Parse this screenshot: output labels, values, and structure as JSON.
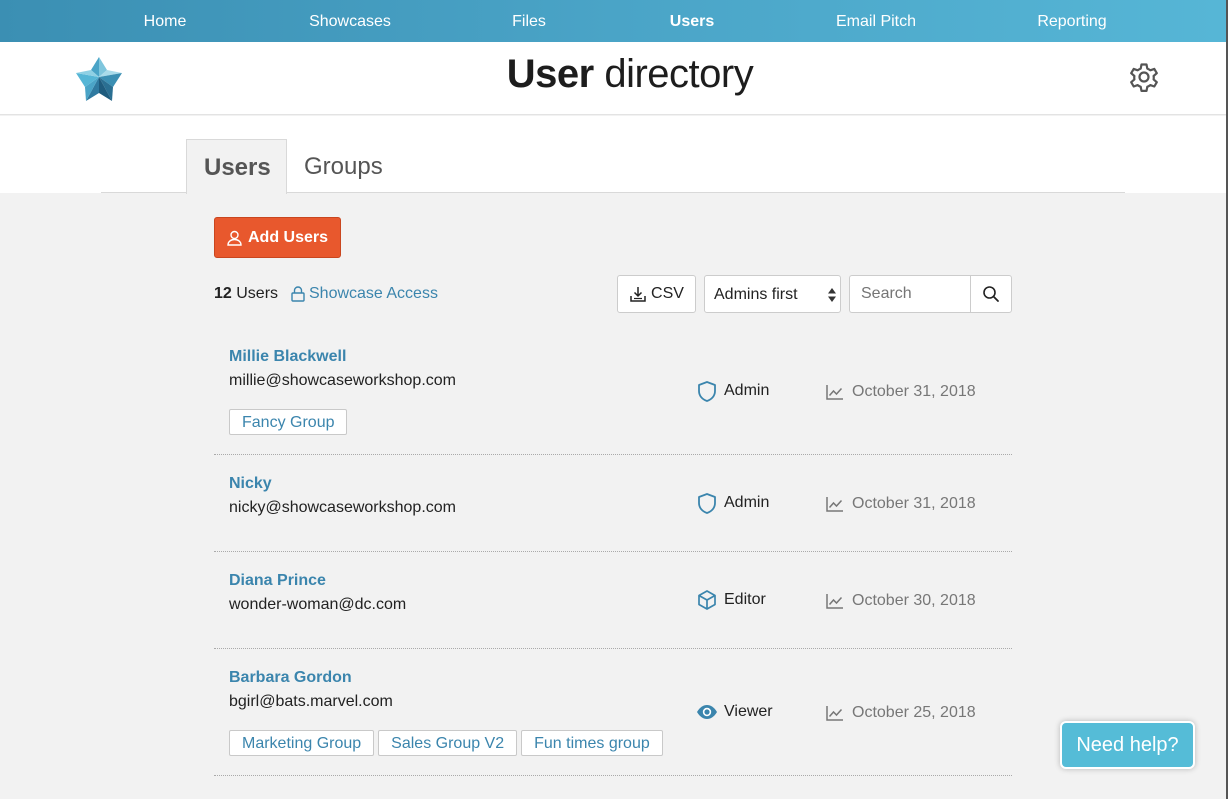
{
  "nav": {
    "items": [
      {
        "label": "Home",
        "active": false
      },
      {
        "label": "Showcases",
        "active": false
      },
      {
        "label": "Files",
        "active": false
      },
      {
        "label": "Users",
        "active": true
      },
      {
        "label": "Email Pitch",
        "active": false
      },
      {
        "label": "Reporting",
        "active": false
      }
    ]
  },
  "header": {
    "title_bold": "User",
    "title_light": "directory",
    "logo_icon": "showcase-star-logo",
    "settings_icon": "gear-icon"
  },
  "tabs": [
    {
      "label": "Users",
      "active": true
    },
    {
      "label": "Groups",
      "active": false
    }
  ],
  "toolbar": {
    "add_users_label": "Add Users",
    "user_count": "12",
    "users_word": "Users",
    "access_label": "Showcase Access",
    "csv_label": "CSV",
    "sort_value": "Admins first",
    "search_placeholder": "Search"
  },
  "users": [
    {
      "name": "Millie Blackwell",
      "email": "millie@showcaseworkshop.com",
      "groups": [
        "Fancy Group"
      ],
      "role": "Admin",
      "role_icon": "shield-icon",
      "date": "October 31, 2018"
    },
    {
      "name": "Nicky",
      "email": "nicky@showcaseworkshop.com",
      "groups": [],
      "role": "Admin",
      "role_icon": "shield-icon",
      "date": "October 31, 2018"
    },
    {
      "name": "Diana Prince",
      "email": "wonder-woman@dc.com",
      "groups": [],
      "role": "Editor",
      "role_icon": "cube-icon",
      "date": "October 30, 2018"
    },
    {
      "name": "Barbara Gordon",
      "email": "bgirl@bats.marvel.com",
      "groups": [
        "Marketing Group",
        "Sales Group V2",
        "Fun times group"
      ],
      "role": "Viewer",
      "role_icon": "eye-icon",
      "date": "October 25, 2018"
    }
  ],
  "help": {
    "label": "Need help?"
  },
  "colors": {
    "nav_start": "#3b8fb3",
    "nav_end": "#56b6d6",
    "accent_orange": "#e8582d",
    "link_blue": "#3b85ad",
    "help_blue": "#55bcd7"
  }
}
